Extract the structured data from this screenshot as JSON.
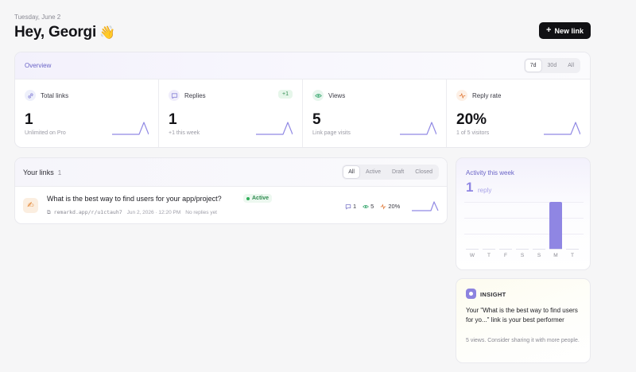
{
  "header": {
    "date": "Tuesday, June 2",
    "greeting": "Hey, Georgi",
    "greeting_emoji": "👋",
    "new_link_icon": "+",
    "new_link_label": "New link"
  },
  "overview": {
    "title": "Overview",
    "ranges": [
      "7d",
      "30d",
      "All"
    ],
    "selected_range": "7d",
    "stats": [
      {
        "icon": "link-icon",
        "label": "Total links",
        "badge": "",
        "value": "1",
        "sub": "Unlimited on Pro"
      },
      {
        "icon": "message-icon",
        "label": "Replies",
        "badge": "+1",
        "value": "1",
        "sub": "+1 this week"
      },
      {
        "icon": "eye-icon",
        "label": "Views",
        "badge": "",
        "value": "5",
        "sub": "Link page visits"
      },
      {
        "icon": "activity-icon",
        "label": "Reply rate",
        "badge": "",
        "value": "20%",
        "sub": "1 of 5 visitors"
      }
    ]
  },
  "links": {
    "title": "Your links",
    "count": "1",
    "filters": [
      "All",
      "Active",
      "Draft",
      "Closed"
    ],
    "selected_filter": "All",
    "items": [
      {
        "question": "What is the best way to find users for your app/project?",
        "status": "Active",
        "url": "remarkd.app/r/u1ctauh7",
        "created": "Jun 2, 2026 · 12:20 PM",
        "replies_note": "No replies yet",
        "replies": "1",
        "views": "5",
        "rate": "20%"
      }
    ]
  },
  "activity": {
    "title": "Activity this week",
    "value": "1",
    "unit": "reply",
    "days": [
      "W",
      "T",
      "F",
      "S",
      "S",
      "M",
      "T"
    ],
    "counts": [
      0,
      0,
      0,
      0,
      0,
      1,
      0
    ]
  },
  "insight": {
    "label": "INSIGHT",
    "text": "Your \"What is the best way to find users for yo...\" link is your best performer",
    "note": "5 views. Consider sharing it with more people."
  },
  "colors": {
    "accent": "#8f86e3",
    "success": "#2fae5a",
    "primary_button": "#111114"
  }
}
